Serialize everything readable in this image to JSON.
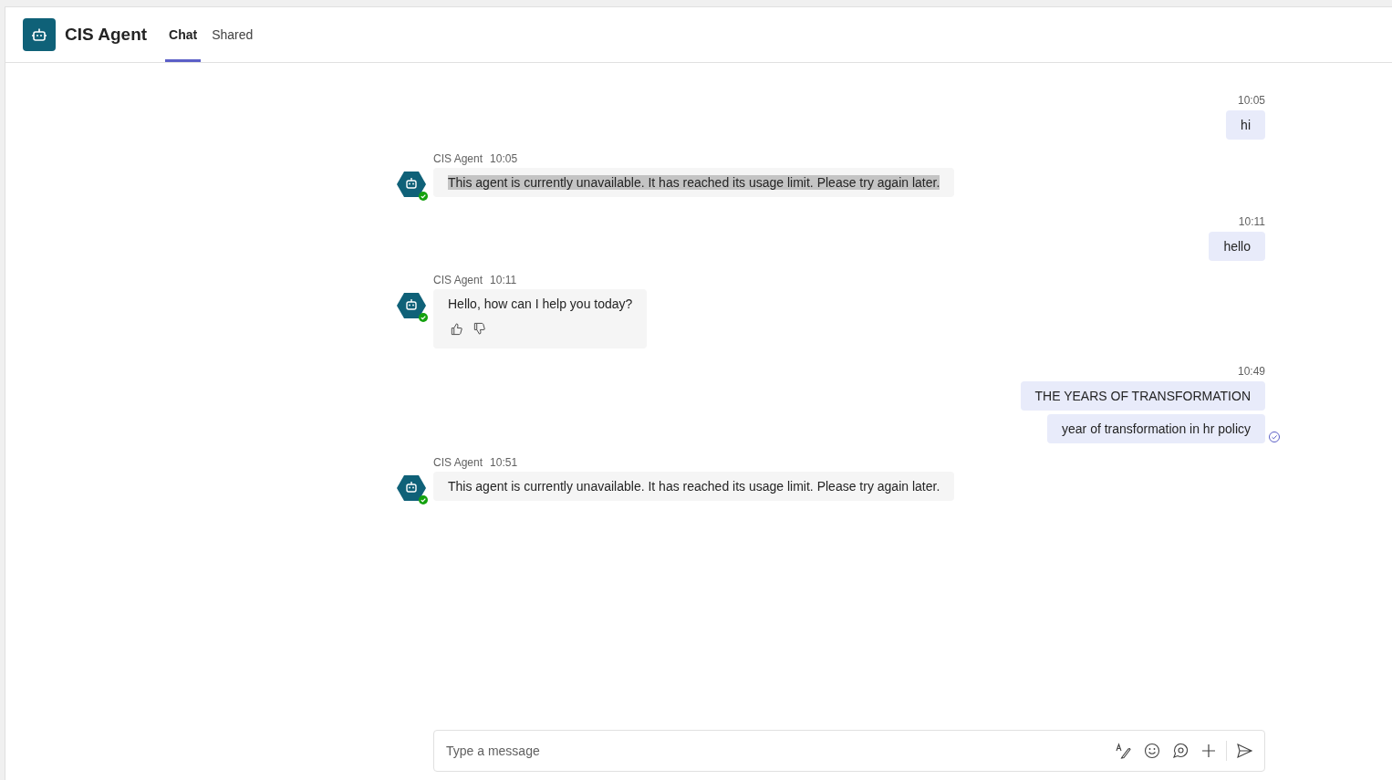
{
  "header": {
    "title": "CIS Agent",
    "tabs": [
      {
        "label": "Chat",
        "selected": true
      },
      {
        "label": "Shared",
        "selected": false
      }
    ]
  },
  "messages": [
    {
      "kind": "sent",
      "time": "10:05",
      "bubbles": [
        "hi"
      ],
      "read": false
    },
    {
      "kind": "received",
      "sender": "CIS Agent",
      "time": "10:05",
      "text": "This agent is currently unavailable. It has reached its usage limit. Please try again later.",
      "highlighted": true,
      "feedback": false
    },
    {
      "kind": "sent",
      "time": "10:11",
      "bubbles": [
        "hello"
      ],
      "read": false
    },
    {
      "kind": "received",
      "sender": "CIS Agent",
      "time": "10:11",
      "text": "Hello, how can I help you today?",
      "highlighted": false,
      "feedback": true
    },
    {
      "kind": "sent",
      "time": "10:49",
      "bubbles": [
        "THE YEARS OF TRANSFORMATION",
        "year of transformation in hr policy"
      ],
      "read": true
    },
    {
      "kind": "received",
      "sender": "CIS Agent",
      "time": "10:51",
      "text": "This agent is currently unavailable. It has reached its usage limit. Please try again later.",
      "highlighted": false,
      "feedback": false
    }
  ],
  "composer": {
    "placeholder": "Type a message"
  }
}
